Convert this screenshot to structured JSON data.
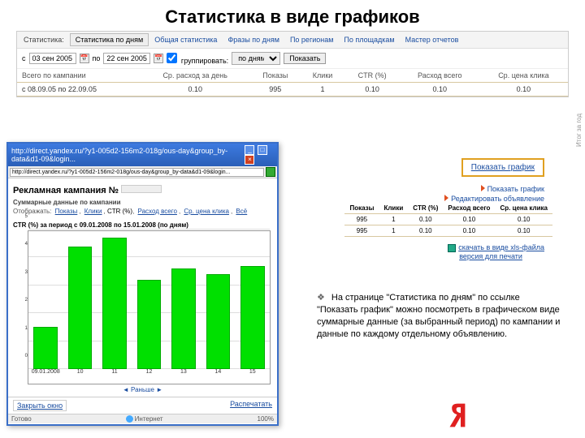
{
  "slide": {
    "title": "Статистика в виде графиков"
  },
  "tabs": {
    "label": "Статистика:",
    "items": [
      "Статистика по дням",
      "Общая статистика",
      "Фразы по дням",
      "По регионам",
      "По площадкам",
      "Мастер отчетов"
    ],
    "active_index": 0
  },
  "filter": {
    "from_label": "с",
    "date_from": "03 сен 2005",
    "to_label": "по",
    "date_to": "22 сен 2005",
    "group_label": "группировать:",
    "group_value": "по дням",
    "show_btn": "Показать"
  },
  "main_table": {
    "headers": [
      "Всего по кампании",
      "Ср. расход за день",
      "Показы",
      "Клики",
      "CTR (%)",
      "Расход всего",
      "Ср. цена клика"
    ],
    "row_label": "с 08.09.05 по 22.09.05",
    "cells": [
      "0.10",
      "995",
      "1",
      "0.10",
      "0.10",
      "0.10"
    ],
    "side_label": "Итог за год"
  },
  "links": {
    "show_graph": "Показать график",
    "sub1": "Показать график",
    "sub2": "Редактировать объявление"
  },
  "mini_table": {
    "headers": [
      "Показы",
      "Клики",
      "CTR (%)",
      "Расход всего",
      "Ср. цена клика"
    ],
    "rows": [
      [
        "995",
        "1",
        "0.10",
        "0.10",
        "0.10"
      ],
      [
        "995",
        "1",
        "0.10",
        "0.10",
        "0.10"
      ]
    ]
  },
  "xls": {
    "line1": "скачать в виде xls-файла",
    "line2": "версия для печати"
  },
  "description": {
    "bullet": "❖",
    "text": "На странице \"Статистика по дням\" по ссылке \"Показать график\" можно посмотреть в графическом виде суммарные данные (за выбранный период) по кампании и данные по каждому отдельному объявлению."
  },
  "popup": {
    "titlebar": "http://direct.yandex.ru/?y1-005d2-156m2-018g/ous-day&group_by-data&d1-09&login...",
    "camp_title": "Рекламная кампания №",
    "summary_label": "Суммарные данные по кампании",
    "display_label": "Отображать:",
    "metrics": [
      "Показы",
      "Клики",
      "CTR (%)",
      "Расход всего",
      "Ср. цена клика",
      "Всё"
    ],
    "metric_current_index": 2,
    "chart_title": "CTR (%) за период с 09.01.2008 по 15.01.2008 (по дням)",
    "close_btn": "Закрыть окно",
    "print": "Распечатать",
    "status_left": "Готово",
    "status_mid": "Интернет",
    "status_right": "100%"
  },
  "chart_data": {
    "type": "bar",
    "title": "CTR (%) за период с 09.01.2008 по 15.01.2008 (по дням)",
    "xlabel": "",
    "ylabel": "",
    "ylim": [
      0,
      5
    ],
    "categories": [
      "09.01.2008",
      "10",
      "11",
      "12",
      "13",
      "14",
      "15"
    ],
    "values": [
      1.5,
      4.4,
      4.7,
      3.2,
      3.6,
      3.4,
      3.7
    ]
  }
}
